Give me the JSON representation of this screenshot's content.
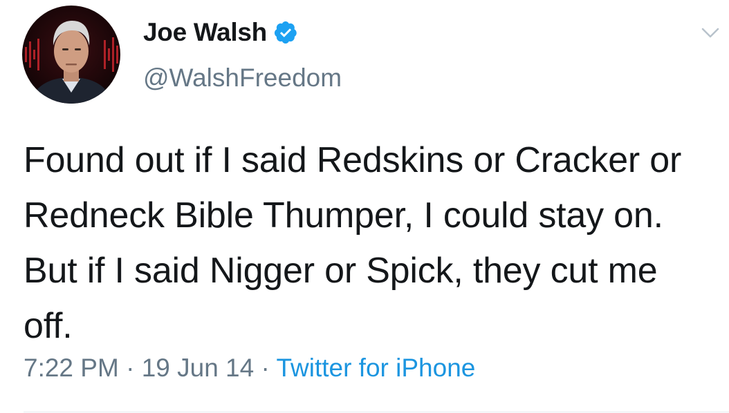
{
  "user": {
    "display_name": "Joe Walsh",
    "handle": "@WalshFreedom",
    "verified_icon": "verified-badge-icon",
    "avatar_icon": "profile-photo"
  },
  "tweet": {
    "text": "Found out if I said Redskins or Cracker or Redneck Bible Thumper, I could stay on. But if I said Nigger or Spick, they cut me off.",
    "time": "7:22 PM",
    "separator": " · ",
    "date": "19 Jun 14",
    "source": "Twitter for iPhone"
  },
  "menu": {
    "icon": "chevron-down-icon"
  },
  "colors": {
    "text": "#14171a",
    "secondary": "#657786",
    "link": "#1b95e0",
    "verified": "#1da1f2"
  }
}
